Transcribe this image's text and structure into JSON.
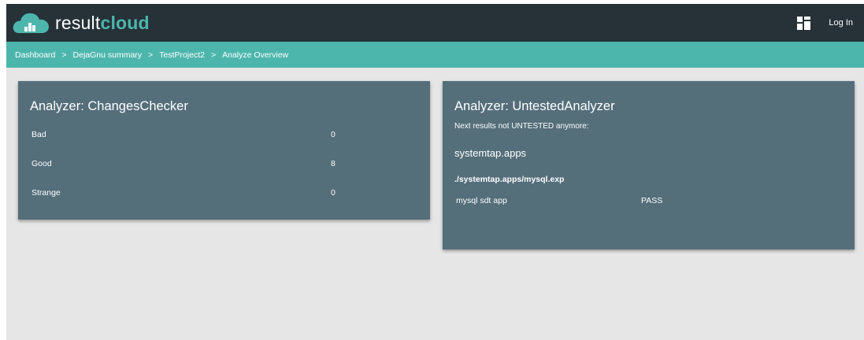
{
  "brand": {
    "name_part1": "result",
    "name_part2": "cloud"
  },
  "navbar": {
    "login_label": "Log In",
    "dashboard_icon": "grid-dashboard-icon",
    "logo_icon": "cloud-chart-icon"
  },
  "breadcrumb": {
    "items": [
      "Dashboard",
      "DejaGnu summary",
      "TestProject2",
      "Analyze Overview"
    ],
    "separator": ">"
  },
  "changes_checker": {
    "title": "Analyzer: ChangesChecker",
    "rows": [
      {
        "label": "Bad",
        "value": "0"
      },
      {
        "label": "Good",
        "value": "8"
      },
      {
        "label": "Strange",
        "value": "0"
      }
    ]
  },
  "untested_analyzer": {
    "title": "Analyzer: UntestedAnalyzer",
    "note": "Next results not UNTESTED anymore:",
    "section": "systemtap.apps",
    "path": "./systemtap.apps/mysql.exp",
    "results": [
      {
        "name": "mysql sdt app",
        "status": "PASS"
      }
    ]
  },
  "colors": {
    "navbar": "#263238",
    "accent": "#4db6ac",
    "card": "#546e7a",
    "background": "#e6e6e6"
  }
}
